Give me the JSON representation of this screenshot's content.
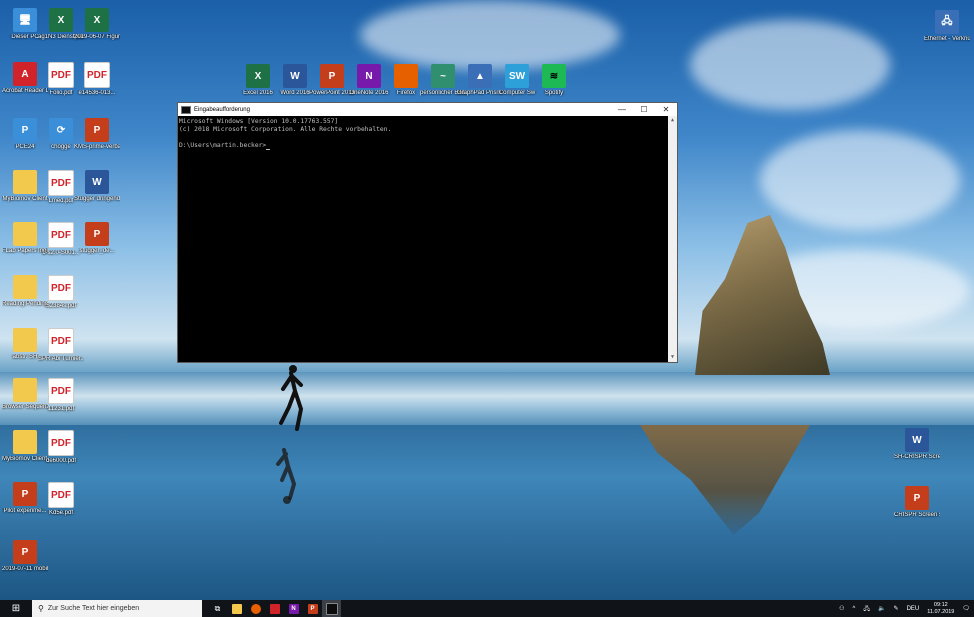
{
  "desktop": {
    "icons_left": [
      {
        "label": "Dieser PC",
        "type": "pc",
        "glyph": "🖥"
      },
      {
        "label": "ag1N3 Dienstplan...",
        "type": "excel",
        "glyph": "X"
      },
      {
        "label": "2019-06-07 Figure, Xi...",
        "type": "excel",
        "glyph": "X"
      },
      {
        "label": "Acrobat Reader DC",
        "type": "acrobat",
        "glyph": "A"
      },
      {
        "label": "Folio.pdf",
        "type": "pdf",
        "glyph": "PDF"
      },
      {
        "label": "e14536-013...",
        "type": "pdf",
        "glyph": "PDF"
      },
      {
        "label": "PCE24",
        "type": "pc",
        "glyph": "P"
      },
      {
        "label": "chogge",
        "type": "pc",
        "glyph": "⟳"
      },
      {
        "label": "KMS-prime-verband.ppsx",
        "type": "ppt",
        "glyph": "P"
      },
      {
        "label": "MyBiomov Client",
        "type": "folder",
        "glyph": ""
      },
      {
        "label": "Lmed.pdf",
        "type": "pdf",
        "glyph": "PDF"
      },
      {
        "label": "Stugger dringend.docx",
        "type": "word",
        "glyph": "W"
      },
      {
        "label": "FLab Papers Ingenieria",
        "type": "folder",
        "glyph": ""
      },
      {
        "label": "1-s2.0-S001...",
        "type": "pdf",
        "glyph": "PDF"
      },
      {
        "label": "stugger_de...",
        "type": "ppt",
        "glyph": "P"
      },
      {
        "label": "Reading Pending",
        "type": "folder",
        "glyph": ""
      },
      {
        "label": "S2384s.pdf",
        "type": "pdf",
        "glyph": "PDF"
      },
      {
        "label": "abstr. SH",
        "type": "folder",
        "glyph": ""
      },
      {
        "label": "SPR Abi Turnier...",
        "type": "pdf",
        "glyph": "PDF"
      },
      {
        "label": "Browser Sequenz...",
        "type": "folder",
        "glyph": ""
      },
      {
        "label": "11231.pdf",
        "type": "pdf",
        "glyph": "PDF"
      },
      {
        "label": "MyBiomov Client_alt...",
        "type": "folder",
        "glyph": ""
      },
      {
        "label": "de6000.pdf",
        "type": "pdf",
        "glyph": "PDF"
      },
      {
        "label": "Pilot experime...",
        "type": "ppt",
        "glyph": "P"
      },
      {
        "label": "Kd5e.pdf",
        "type": "pdf",
        "glyph": "PDF"
      },
      {
        "label": "2019-07-11 mobility...",
        "type": "ppt",
        "glyph": "P"
      }
    ],
    "icons_top": [
      {
        "label": "Excel 2016",
        "type": "excel",
        "glyph": "X"
      },
      {
        "label": "Word 2016",
        "type": "word",
        "glyph": "W"
      },
      {
        "label": "PowerPoint 2016",
        "type": "ppt",
        "glyph": "P"
      },
      {
        "label": "OneNote 2016",
        "type": "onenote",
        "glyph": "N"
      },
      {
        "label": "Firefox",
        "type": "firefox",
        "glyph": ""
      },
      {
        "label": "persönlicher Bildschirm...",
        "type": "greenicon",
        "glyph": "~"
      },
      {
        "label": "GraphPad Prism 8",
        "type": "net",
        "glyph": "▲"
      },
      {
        "label": "Computer Sw",
        "type": "sw",
        "glyph": "SW"
      },
      {
        "label": "Spotify",
        "type": "spotify",
        "glyph": "≋"
      }
    ],
    "icons_right": [
      {
        "label": "Ethernet - Verknüpfung",
        "type": "net",
        "glyph": "🖧"
      },
      {
        "label": "SH-CRISPR Screenshots",
        "type": "word",
        "glyph": "W"
      },
      {
        "label": "CRISPR Screen sch...",
        "type": "ppt",
        "glyph": "P"
      }
    ]
  },
  "cmd_window": {
    "title": "Eingabeaufforderung",
    "minimize": "—",
    "maximize": "☐",
    "close": "✕",
    "lines": [
      "Microsoft Windows [Version 10.0.17763.557]",
      "(c) 2018 Microsoft Corporation. Alle Rechte vorbehalten.",
      "",
      "D:\\Users\\martin.becker>"
    ]
  },
  "taskbar": {
    "start_glyph": "⊞",
    "search_placeholder": "Zur Suche Text hier eingeben",
    "tray_text": "DEU",
    "time": "09:12",
    "date": "11.07.2019"
  }
}
